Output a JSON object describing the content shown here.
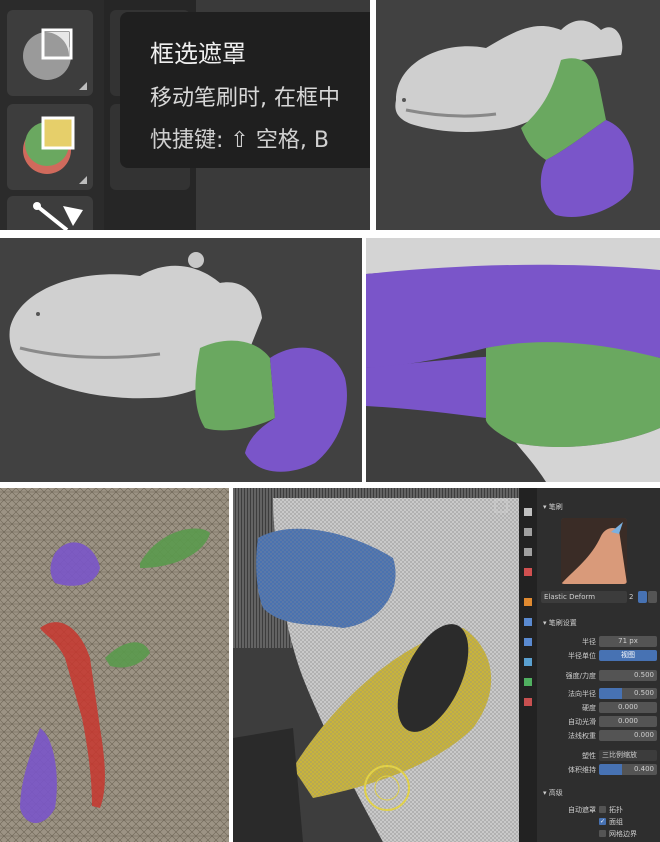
{
  "tooltip": {
    "title": "框选遮罩",
    "line1": "移动笔刷时, 在框中",
    "line2": "快捷键: ⇧ 空格, B"
  },
  "blender_panel": {
    "header": "笔刷",
    "brush_name": "Elastic Deform",
    "brush_users": "2",
    "section_brush_settings": "笔刷设置",
    "radius_label": "半径",
    "radius_value": "71 px",
    "radius_unit_label": "半径单位",
    "radius_unit_value": "视图",
    "strength_label": "强度/力度",
    "strength_value": "0.500",
    "normal_radius_label": "法向半径",
    "normal_radius_value": "0.500",
    "hardness_label": "硬度",
    "hardness_value": "0.000",
    "autosmooth_label": "自动光滑",
    "autosmooth_value": "0.000",
    "normal_weight_label": "法线权重",
    "normal_weight_value": "0.000",
    "deform_label": "塑性",
    "deform_value": "三比例缩放",
    "volume_label": "体积维持",
    "volume_value": "0.400",
    "section_advanced": "高级",
    "automask_label": "自动遮罩",
    "automask_opt1": "拓扑",
    "automask_opt2": "面组",
    "automask_opt3": "网格边界"
  },
  "colors": {
    "mask_green": "#6aa860",
    "mask_purple": "#7a55c9",
    "mask_red": "#c8362e",
    "mask_blue": "#3f6da8",
    "mask_yellow": "#c9b43a",
    "accent_blue": "#4772b3"
  }
}
